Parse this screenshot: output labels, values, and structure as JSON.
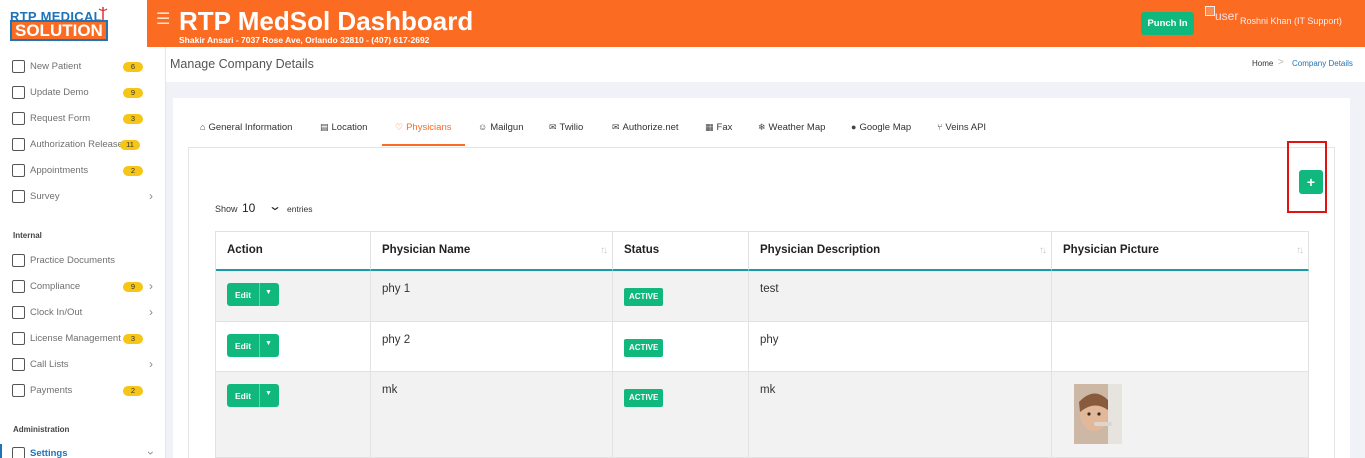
{
  "brand": {
    "logo_top": "RTP MEDICAL",
    "logo_bottom": "SOLUTION"
  },
  "header": {
    "title": "RTP MedSol Dashboard",
    "address": "Shakir Ansari - 7037 Rose Ave, Orlando 32810 - (407) 617-2692",
    "punch_label": "Punch In",
    "user_alt": "user",
    "user_name": "Roshni Khan (IT Support)"
  },
  "sidebar": {
    "items_top": [
      {
        "label": "New Patient",
        "badge": "6",
        "icon": "clipboard-icon"
      },
      {
        "label": "Update Demo",
        "badge": "9",
        "icon": "id-card-icon"
      },
      {
        "label": "Request Form",
        "badge": "3",
        "icon": "form-icon"
      },
      {
        "label": "Authorization Release",
        "badge": "11",
        "icon": "authorization-icon"
      },
      {
        "label": "Appointments",
        "badge": "2",
        "icon": "calendar-icon"
      },
      {
        "label": "Survey",
        "badge": "",
        "icon": "survey-icon",
        "chevron": true
      }
    ],
    "section_internal": "Internal",
    "items_internal": [
      {
        "label": "Practice Documents",
        "badge": "",
        "icon": "documents-icon"
      },
      {
        "label": "Compliance",
        "badge": "9",
        "icon": "compliance-icon",
        "chevron": true
      },
      {
        "label": "Clock In/Out",
        "badge": "",
        "icon": "clock-icon",
        "chevron": true
      },
      {
        "label": "License Management",
        "badge": "3",
        "icon": "license-icon"
      },
      {
        "label": "Call Lists",
        "badge": "",
        "icon": "call-list-icon",
        "chevron": true
      },
      {
        "label": "Payments",
        "badge": "2",
        "icon": "payments-icon"
      }
    ],
    "section_admin": "Administration",
    "settings_label": "Settings"
  },
  "page": {
    "title": "Manage Company Details",
    "breadcrumb_home": "Home",
    "breadcrumb_sep": ">",
    "breadcrumb_current": "Company Details"
  },
  "tabs": [
    {
      "label": "General Information",
      "icon": "home-icon"
    },
    {
      "label": "Location",
      "icon": "map-icon"
    },
    {
      "label": "Physicians",
      "icon": "heart-icon"
    },
    {
      "label": "Mailgun",
      "icon": "user-icon"
    },
    {
      "label": "Twilio",
      "icon": "envelope-icon"
    },
    {
      "label": "Authorize.net",
      "icon": "envelope-icon"
    },
    {
      "label": "Fax",
      "icon": "fax-icon"
    },
    {
      "label": "Weather Map",
      "icon": "snowflake-icon"
    },
    {
      "label": "Google Map",
      "icon": "pin-icon"
    },
    {
      "label": "Veins API",
      "icon": "branch-icon"
    }
  ],
  "active_tab": "Physicians",
  "add_button": "+",
  "entries": {
    "show_label": "Show",
    "value": "10",
    "entries_label": "entries"
  },
  "table": {
    "columns": [
      "Action",
      "Physician Name",
      "Status",
      "Physician Description",
      "Physician Picture"
    ],
    "rows": [
      {
        "action": "Edit",
        "name": "phy 1",
        "status": "ACTIVE",
        "description": "test",
        "has_picture": false
      },
      {
        "action": "Edit",
        "name": "phy 2",
        "status": "ACTIVE",
        "description": "phy",
        "has_picture": false
      },
      {
        "action": "Edit",
        "name": "mk",
        "status": "ACTIVE",
        "description": "mk",
        "has_picture": true
      }
    ]
  },
  "colors": {
    "brand_orange": "#fb6b22",
    "accent_green": "#10b87d",
    "link_blue": "#1f73b7",
    "badge_yellow": "#f5c518"
  }
}
